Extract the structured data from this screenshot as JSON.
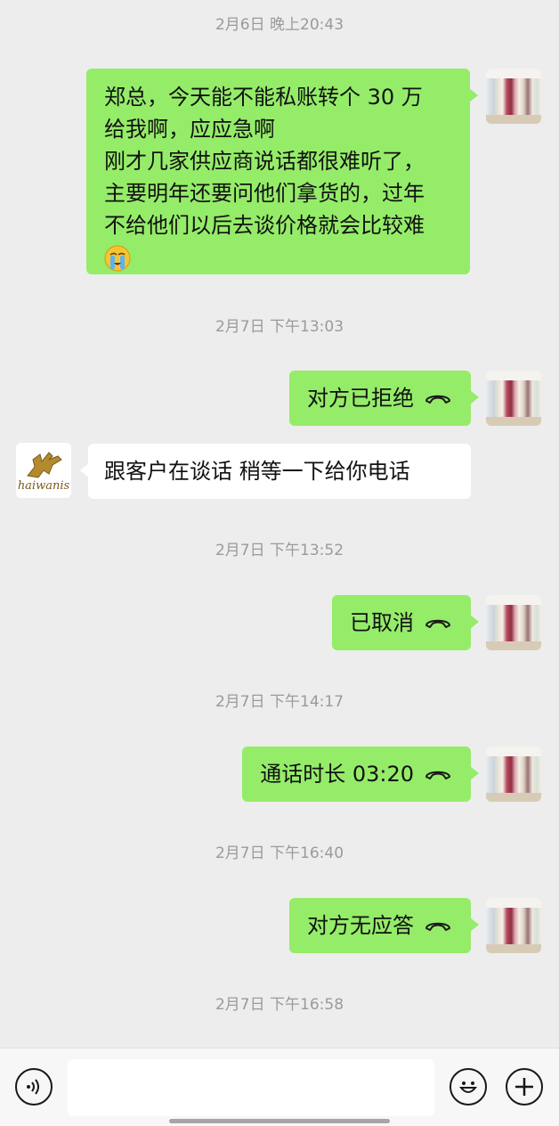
{
  "messages": [
    {
      "type": "timestamp",
      "text": "2月6日 晚上20:43"
    },
    {
      "type": "text",
      "from": "me",
      "lines": [
        "郑总，今天能不能私账转个 30 万",
        "给我啊，应应急啊",
        "刚才几家供应商说话都很难听了，",
        "主要明年还要问他们拿货的，过年",
        "不给他们以后去谈价格就会比较难"
      ],
      "emoji": "crying-face"
    },
    {
      "type": "timestamp",
      "text": "2月7日 下午13:03"
    },
    {
      "type": "call",
      "from": "me",
      "text": "对方已拒绝",
      "icon": "phone-hangup-icon"
    },
    {
      "type": "text",
      "from": "other",
      "lines": [
        "跟客户在谈话  稍等一下给你电话"
      ],
      "avatar_brand": "haiwanis"
    },
    {
      "type": "timestamp",
      "text": "2月7日 下午13:52"
    },
    {
      "type": "call",
      "from": "me",
      "text": "已取消",
      "icon": "phone-hangup-icon"
    },
    {
      "type": "timestamp",
      "text": "2月7日 下午14:17"
    },
    {
      "type": "call",
      "from": "me",
      "text": "通话时长 03:20",
      "icon": "phone-hangup-icon"
    },
    {
      "type": "timestamp",
      "text": "2月7日 下午16:40"
    },
    {
      "type": "call",
      "from": "me",
      "text": "对方无应答",
      "icon": "phone-hangup-icon"
    },
    {
      "type": "timestamp",
      "text": "2月7日 下午16:58"
    }
  ],
  "input_bar": {
    "voice_icon": "voice-icon",
    "input_value": "",
    "emoji_icon": "emoji-icon",
    "add_icon": "plus-icon"
  },
  "colors": {
    "background": "#ededed",
    "my_bubble": "#95ec69",
    "other_bubble": "#ffffff",
    "timestamp": "#9a9a9a"
  }
}
